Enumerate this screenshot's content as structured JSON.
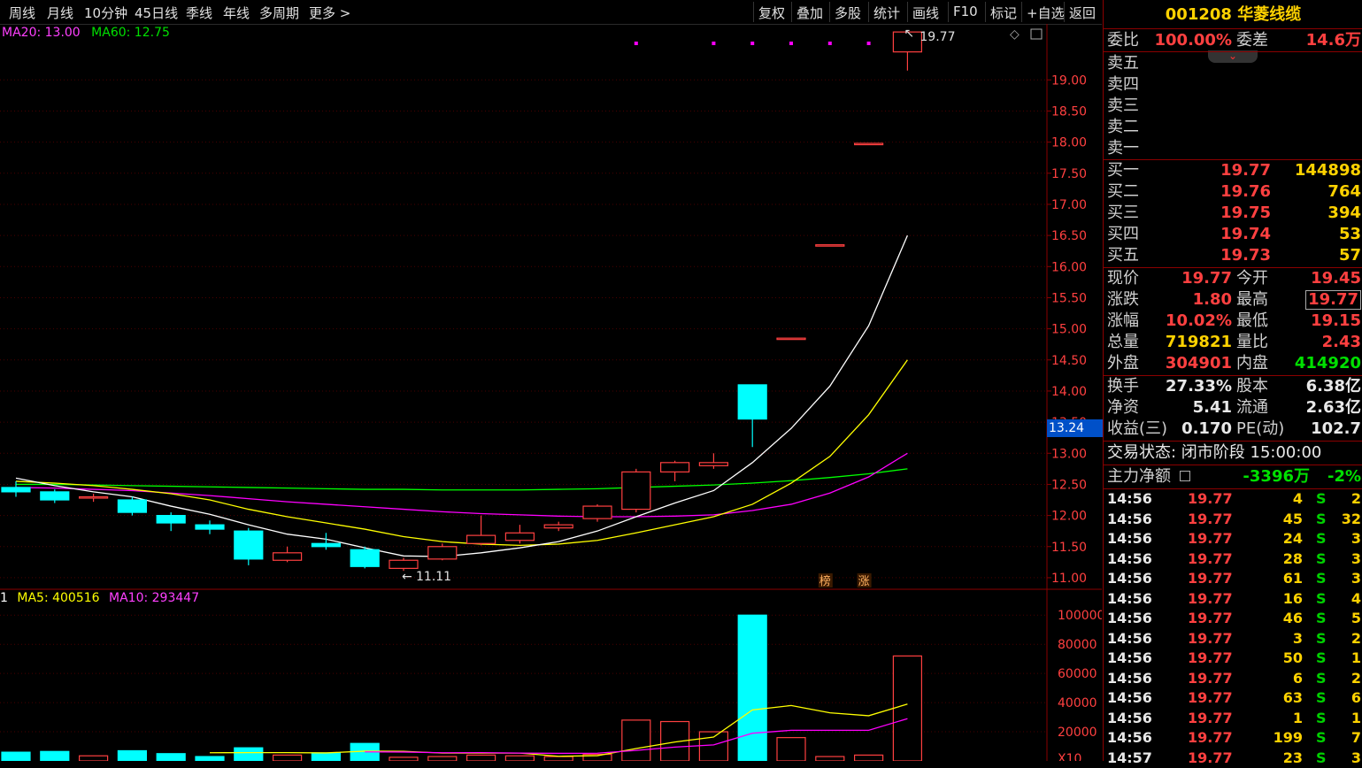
{
  "toolbar": {
    "left_items": [
      "周线",
      "月线",
      "10分钟",
      "45日线",
      "季线",
      "年线",
      "多周期",
      "更多 >"
    ],
    "right_items": [
      "复权",
      "叠加",
      "多股",
      "统计",
      "画线",
      "F10",
      "标记",
      "+自选",
      "返回"
    ]
  },
  "ma_legend": {
    "ma20": "MA20: 13.00",
    "ma60": "MA60: 12.75"
  },
  "vol_legend": {
    "prefix": "1",
    "ma5": "MA5: 400516",
    "ma10": "MA10: 293447"
  },
  "current_price_tag": "13.24",
  "annotations": {
    "high": "19.77",
    "low": "11.11",
    "mark1": "榜",
    "mark2": "涨"
  },
  "price_axis": [
    "19.00",
    "18.50",
    "18.00",
    "17.50",
    "17.00",
    "16.50",
    "16.00",
    "15.50",
    "15.00",
    "14.50",
    "14.00",
    "13.50",
    "13.00",
    "12.50",
    "12.00",
    "11.50",
    "11.00"
  ],
  "volume_axis": [
    "100000",
    "80000",
    "60000",
    "40000",
    "20000",
    "X10"
  ],
  "colors": {
    "up": "#ff4040",
    "down": "#00ffff",
    "ma5": "#ffffff",
    "ma10": "#ffff00",
    "ma20": "#ff00ff",
    "ma60": "#00ff00"
  },
  "chart_data": {
    "type": "candlestick",
    "candles": [
      {
        "o": 12.45,
        "c": 12.38,
        "h": 12.55,
        "l": 12.3
      },
      {
        "o": 12.38,
        "c": 12.25,
        "h": 12.42,
        "l": 12.2
      },
      {
        "o": 12.28,
        "c": 12.3,
        "h": 12.35,
        "l": 12.22
      },
      {
        "o": 12.25,
        "c": 12.05,
        "h": 12.3,
        "l": 12.0
      },
      {
        "o": 12.0,
        "c": 11.88,
        "h": 12.05,
        "l": 11.75
      },
      {
        "o": 11.85,
        "c": 11.78,
        "h": 11.92,
        "l": 11.7
      },
      {
        "o": 11.75,
        "c": 11.3,
        "h": 11.8,
        "l": 11.2
      },
      {
        "o": 11.28,
        "c": 11.4,
        "h": 11.5,
        "l": 11.25
      },
      {
        "o": 11.55,
        "c": 11.5,
        "h": 11.72,
        "l": 11.45
      },
      {
        "o": 11.45,
        "c": 11.18,
        "h": 11.5,
        "l": 11.15
      },
      {
        "o": 11.15,
        "c": 11.28,
        "h": 11.32,
        "l": 11.11
      },
      {
        "o": 11.3,
        "c": 11.5,
        "h": 11.55,
        "l": 11.28
      },
      {
        "o": 11.55,
        "c": 11.68,
        "h": 12.0,
        "l": 11.52
      },
      {
        "o": 11.6,
        "c": 11.72,
        "h": 11.85,
        "l": 11.55
      },
      {
        "o": 11.8,
        "c": 11.85,
        "h": 11.9,
        "l": 11.75
      },
      {
        "o": 11.95,
        "c": 12.15,
        "h": 12.18,
        "l": 11.9
      },
      {
        "o": 12.1,
        "c": 12.7,
        "h": 12.75,
        "l": 12.05
      },
      {
        "o": 12.7,
        "c": 12.85,
        "h": 12.88,
        "l": 12.55
      },
      {
        "o": 12.8,
        "c": 12.85,
        "h": 13.0,
        "l": 12.75
      },
      {
        "o": 14.1,
        "c": 13.55,
        "h": 14.1,
        "l": 13.1
      },
      {
        "o": 14.85,
        "c": 14.85,
        "h": 14.85,
        "l": 14.85
      },
      {
        "o": 16.35,
        "c": 16.35,
        "h": 16.35,
        "l": 16.35
      },
      {
        "o": 17.98,
        "c": 17.98,
        "h": 17.98,
        "l": 17.98
      },
      {
        "o": 19.45,
        "c": 19.77,
        "h": 19.77,
        "l": 19.15
      }
    ],
    "volumes": [
      6000,
      6500,
      3500,
      7000,
      5000,
      3000,
      9000,
      4000,
      5500,
      12000,
      2500,
      3000,
      4000,
      3500,
      3000,
      4500,
      28000,
      27000,
      20000,
      100000,
      16000,
      3000,
      4000,
      72000
    ],
    "ma_lines": {
      "ma5": [
        12.6,
        12.48,
        12.38,
        12.3,
        12.15,
        12.02,
        11.85,
        11.7,
        11.62,
        11.48,
        11.35,
        11.34,
        11.4,
        11.48,
        11.58,
        11.75,
        11.98,
        12.2,
        12.4,
        12.85,
        13.4,
        14.08,
        15.05,
        16.5
      ],
      "ma10": [
        12.55,
        12.52,
        12.48,
        12.42,
        12.35,
        12.25,
        12.1,
        11.98,
        11.88,
        11.78,
        11.66,
        11.58,
        11.54,
        11.52,
        11.54,
        11.6,
        11.72,
        11.85,
        11.98,
        12.18,
        12.52,
        12.95,
        13.62,
        14.5
      ],
      "ma20": [
        12.45,
        12.44,
        12.42,
        12.4,
        12.36,
        12.32,
        12.27,
        12.22,
        12.18,
        12.14,
        12.1,
        12.06,
        12.03,
        12.01,
        11.99,
        11.98,
        11.98,
        11.99,
        12.01,
        12.08,
        12.18,
        12.36,
        12.62,
        13.0
      ],
      "ma60": [
        12.5,
        12.5,
        12.49,
        12.48,
        12.47,
        12.46,
        12.45,
        12.44,
        12.43,
        12.42,
        12.42,
        12.41,
        12.41,
        12.41,
        12.42,
        12.43,
        12.45,
        12.47,
        12.49,
        12.52,
        12.56,
        12.61,
        12.67,
        12.75
      ]
    },
    "vol_ma": {
      "ma5": [
        null,
        null,
        null,
        null,
        null,
        5600,
        5700,
        5700,
        5500,
        6700,
        6600,
        5400,
        5400,
        5400,
        3200,
        3600,
        8500,
        13000,
        16400,
        35000,
        38000,
        33000,
        31000,
        39000
      ],
      "ma10": [
        null,
        null,
        null,
        null,
        null,
        null,
        null,
        null,
        null,
        6200,
        6100,
        5600,
        5700,
        5400,
        5200,
        5300,
        7200,
        9500,
        11000,
        19000,
        21000,
        21000,
        21000,
        29000
      ]
    },
    "ylim": [
      10.8,
      19.9
    ],
    "vol_ylim": [
      0,
      105000
    ]
  },
  "panel": {
    "title": "001208 华菱线缆",
    "weibi_label": "委比",
    "weibi_value": "100.00%",
    "weicha_label": "委差",
    "weicha_value": "14.6万",
    "sell": [
      {
        "label": "卖五",
        "price": "",
        "vol": ""
      },
      {
        "label": "卖四",
        "price": "",
        "vol": ""
      },
      {
        "label": "卖三",
        "price": "",
        "vol": ""
      },
      {
        "label": "卖二",
        "price": "",
        "vol": ""
      },
      {
        "label": "卖一",
        "price": "",
        "vol": ""
      }
    ],
    "buy": [
      {
        "label": "买一",
        "price": "19.77",
        "vol": "144898"
      },
      {
        "label": "买二",
        "price": "19.76",
        "vol": "764"
      },
      {
        "label": "买三",
        "price": "19.75",
        "vol": "394"
      },
      {
        "label": "买四",
        "price": "19.74",
        "vol": "53"
      },
      {
        "label": "买五",
        "price": "19.73",
        "vol": "57"
      }
    ],
    "quote": [
      {
        "l1": "现价",
        "v1": "19.77",
        "c1": "red",
        "l2": "今开",
        "v2": "19.45",
        "c2": "red"
      },
      {
        "l1": "涨跌",
        "v1": "1.80",
        "c1": "red",
        "l2": "最高",
        "v2": "19.77",
        "c2": "red"
      },
      {
        "l1": "涨幅",
        "v1": "10.02%",
        "c1": "red",
        "l2": "最低",
        "v2": "19.15",
        "c2": "red"
      },
      {
        "l1": "总量",
        "v1": "719821",
        "c1": "yellow",
        "l2": "量比",
        "v2": "2.43",
        "c2": "red"
      },
      {
        "l1": "外盘",
        "v1": "304901",
        "c1": "red",
        "l2": "内盘",
        "v2": "414920",
        "c2": "green"
      }
    ],
    "fund": [
      {
        "l1": "换手",
        "v1": "27.33%",
        "l2": "股本",
        "v2": "6.38亿"
      },
      {
        "l1": "净资",
        "v1": "5.41",
        "l2": "流通",
        "v2": "2.63亿"
      },
      {
        "l1": "收益(三)",
        "v1": "0.170",
        "l2": "PE(动)",
        "v2": "102.7"
      }
    ],
    "status": "交易状态: 闭市阶段 15:00:00",
    "main_net_label": "主力净额",
    "main_net_value": "-3396万",
    "main_net_pct": "-2%",
    "ticks": [
      {
        "t": "14:56",
        "p": "19.77",
        "q": "4",
        "s": "S",
        "n": "2"
      },
      {
        "t": "14:56",
        "p": "19.77",
        "q": "45",
        "s": "S",
        "n": "32"
      },
      {
        "t": "14:56",
        "p": "19.77",
        "q": "24",
        "s": "S",
        "n": "3"
      },
      {
        "t": "14:56",
        "p": "19.77",
        "q": "28",
        "s": "S",
        "n": "3"
      },
      {
        "t": "14:56",
        "p": "19.77",
        "q": "61",
        "s": "S",
        "n": "3"
      },
      {
        "t": "14:56",
        "p": "19.77",
        "q": "16",
        "s": "S",
        "n": "4"
      },
      {
        "t": "14:56",
        "p": "19.77",
        "q": "46",
        "s": "S",
        "n": "5"
      },
      {
        "t": "14:56",
        "p": "19.77",
        "q": "3",
        "s": "S",
        "n": "2"
      },
      {
        "t": "14:56",
        "p": "19.77",
        "q": "50",
        "s": "S",
        "n": "1"
      },
      {
        "t": "14:56",
        "p": "19.77",
        "q": "6",
        "s": "S",
        "n": "2"
      },
      {
        "t": "14:56",
        "p": "19.77",
        "q": "63",
        "s": "S",
        "n": "6"
      },
      {
        "t": "14:56",
        "p": "19.77",
        "q": "1",
        "s": "S",
        "n": "1"
      },
      {
        "t": "14:56",
        "p": "19.77",
        "q": "199",
        "s": "S",
        "n": "7"
      },
      {
        "t": "14:57",
        "p": "19.77",
        "q": "23",
        "s": "S",
        "n": "3"
      }
    ]
  }
}
